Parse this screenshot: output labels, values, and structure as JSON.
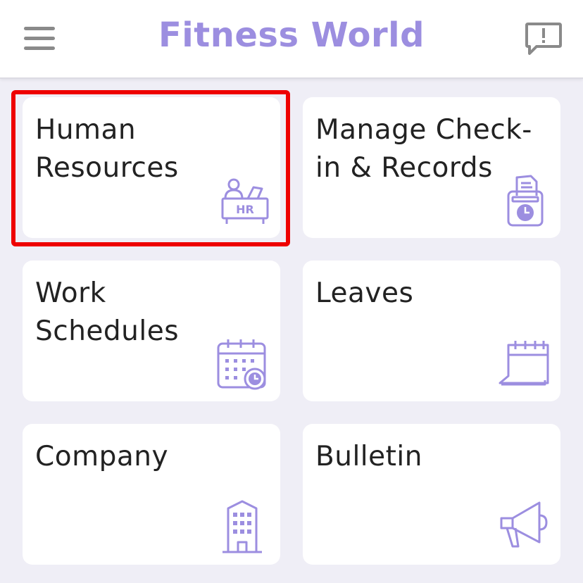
{
  "header": {
    "title": "Fitness World",
    "menu_icon": "hamburger-menu-icon",
    "feedback_icon": "feedback-icon"
  },
  "colors": {
    "accent": "#9c8ee0",
    "background": "#efeef6",
    "card": "#ffffff",
    "highlight": "#ee0000"
  },
  "cards": [
    {
      "label": "Human Resources",
      "icon": "hr-desk-icon"
    },
    {
      "label": "Manage Check-in & Records",
      "icon": "time-clock-icon"
    },
    {
      "label": "Work Schedules",
      "icon": "calendar-clock-icon"
    },
    {
      "label": "Leaves",
      "icon": "calendar-icon"
    },
    {
      "label": "Company",
      "icon": "building-icon"
    },
    {
      "label": "Bulletin",
      "icon": "megaphone-icon"
    }
  ]
}
